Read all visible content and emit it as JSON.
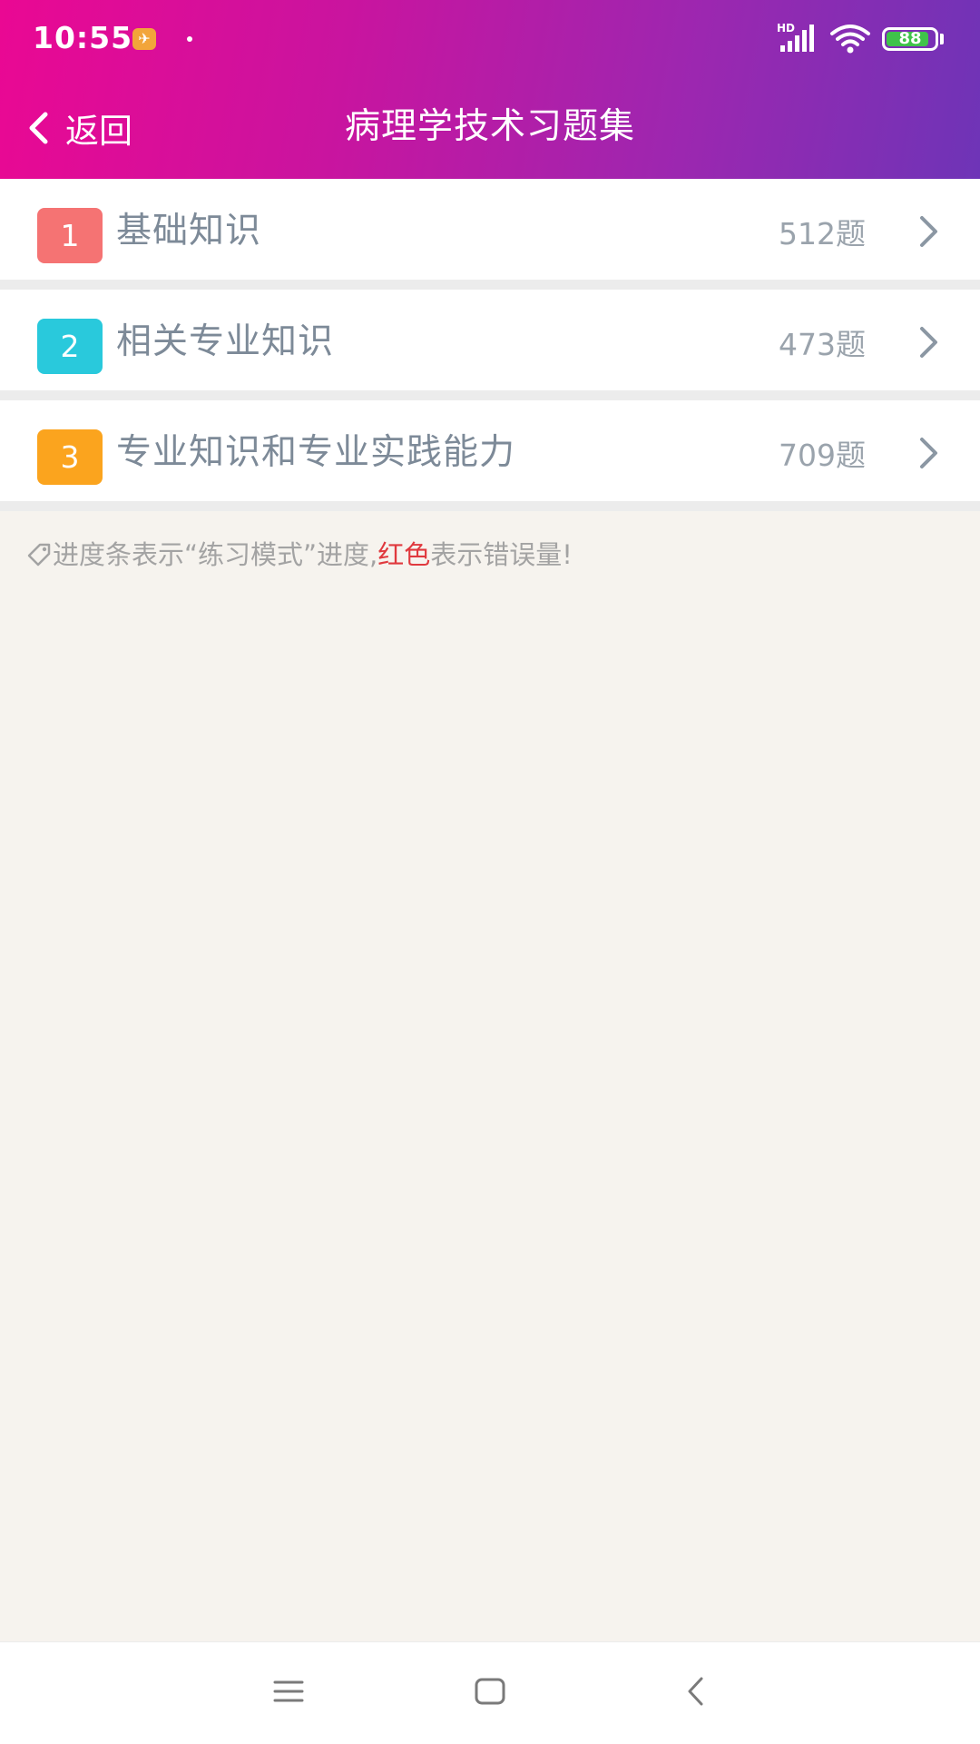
{
  "status_bar": {
    "time": "10:55",
    "battery": "88",
    "network": "HD"
  },
  "header": {
    "back_label": "返回",
    "title": "病理学技术习题集"
  },
  "colors": {
    "gradient_start": "#ea0893",
    "gradient_end": "#6e34b7",
    "badge_1": "#f57373",
    "badge_2": "#29c9dc",
    "badge_3": "#fba41e",
    "error_red": "#e0393e"
  },
  "items": [
    {
      "number": "1",
      "title": "基础知识",
      "count": "512题"
    },
    {
      "number": "2",
      "title": "相关专业知识",
      "count": "473题"
    },
    {
      "number": "3",
      "title": "专业知识和专业实践能力",
      "count": "709题"
    }
  ],
  "note": {
    "prefix": "进度条表示“练习模式”进度,",
    "highlight": "红色",
    "suffix": "表示错误量!"
  },
  "icons": {
    "back": "chevron-left-icon",
    "row_arrow": "chevron-right-icon",
    "note": "tag-icon",
    "nav_menu": "menu-icon",
    "nav_home": "home-square-icon",
    "nav_back": "back-triangle-icon"
  }
}
